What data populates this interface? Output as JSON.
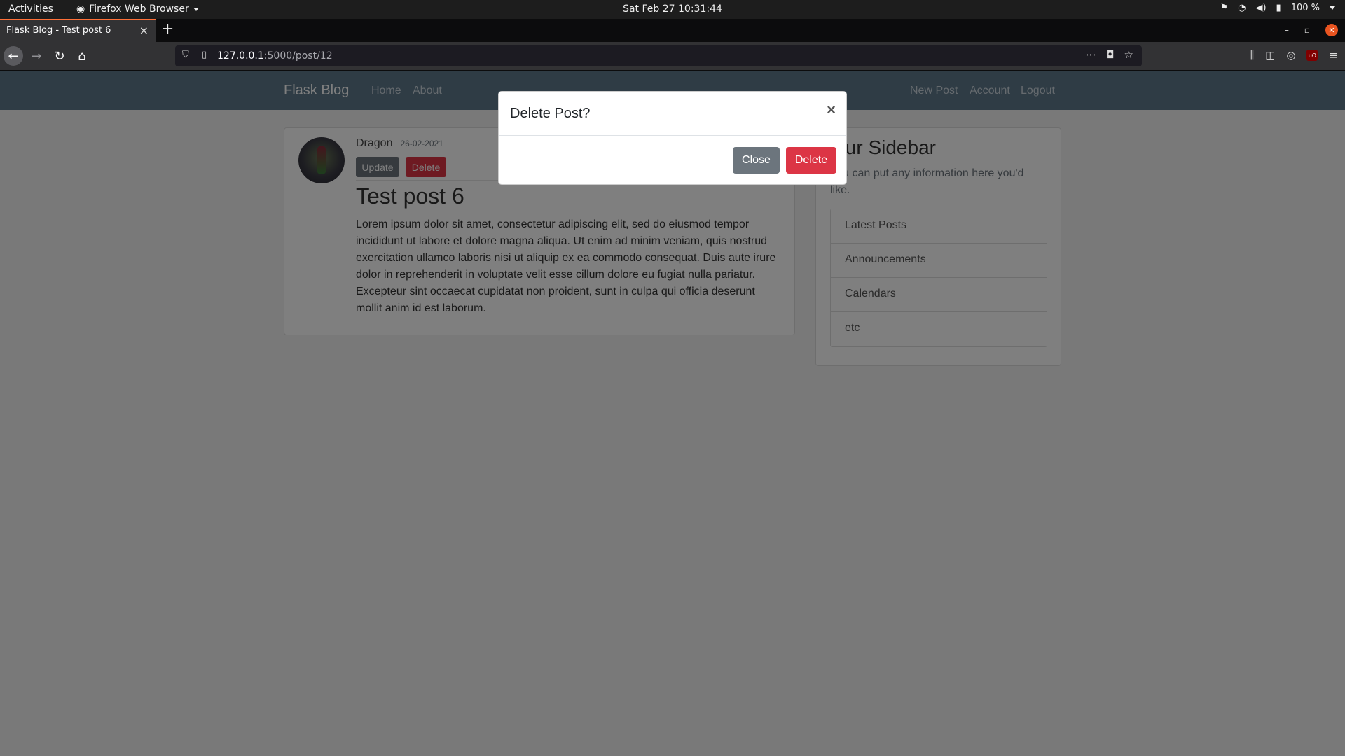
{
  "system_bar": {
    "activities": "Activities",
    "app_name": "Firefox Web Browser",
    "clock": "Sat Feb 27  10:31:44",
    "battery": "100 %"
  },
  "browser": {
    "tab_title": "Flask Blog - Test post 6",
    "url_host": "127.0.0.1",
    "url_path": ":5000/post/12"
  },
  "site_nav": {
    "brand": "Flask Blog",
    "home": "Home",
    "about": "About",
    "new_post": "New Post",
    "account": "Account",
    "logout": "Logout"
  },
  "post": {
    "author": "Dragon",
    "date": "26-02-2021",
    "update_label": "Update",
    "delete_label": "Delete",
    "title": "Test post 6",
    "content": "Lorem ipsum dolor sit amet, consectetur adipiscing elit, sed do eiusmod tempor incididunt ut labore et dolore magna aliqua. Ut enim ad minim veniam, quis nostrud exercitation ullamco laboris nisi ut aliquip ex ea commodo consequat. Duis aute irure dolor in reprehenderit in voluptate velit esse cillum dolore eu fugiat nulla pariatur. Excepteur sint occaecat cupidatat non proident, sunt in culpa qui officia deserunt mollit anim id est laborum."
  },
  "sidebar": {
    "heading": "Our Sidebar",
    "text": "You can put any information here you'd like.",
    "items": [
      "Latest Posts",
      "Announcements",
      "Calendars",
      "etc"
    ]
  },
  "modal": {
    "title": "Delete Post?",
    "close_x": "×",
    "close_label": "Close",
    "delete_label": "Delete"
  },
  "colors": {
    "danger": "#dc3545",
    "secondary": "#6c757d",
    "navbar": "#5f788a",
    "tab_accent": "#ff7139"
  }
}
